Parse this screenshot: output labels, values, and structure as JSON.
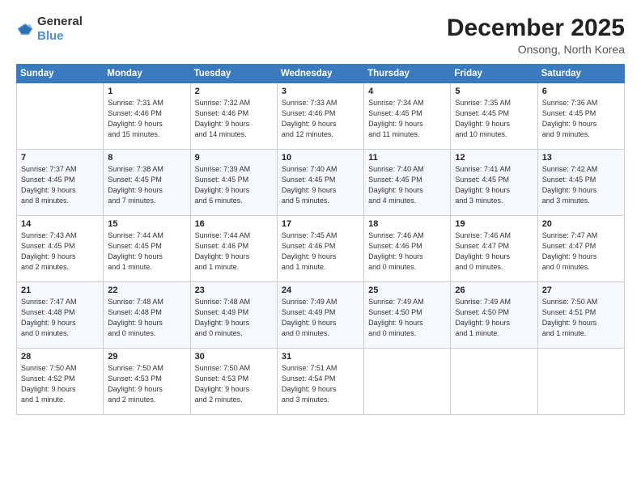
{
  "header": {
    "logo_general": "General",
    "logo_blue": "Blue",
    "month": "December 2025",
    "location": "Onsong, North Korea"
  },
  "days_of_week": [
    "Sunday",
    "Monday",
    "Tuesday",
    "Wednesday",
    "Thursday",
    "Friday",
    "Saturday"
  ],
  "weeks": [
    [
      {
        "day": "",
        "info": ""
      },
      {
        "day": "1",
        "info": "Sunrise: 7:31 AM\nSunset: 4:46 PM\nDaylight: 9 hours\nand 15 minutes."
      },
      {
        "day": "2",
        "info": "Sunrise: 7:32 AM\nSunset: 4:46 PM\nDaylight: 9 hours\nand 14 minutes."
      },
      {
        "day": "3",
        "info": "Sunrise: 7:33 AM\nSunset: 4:46 PM\nDaylight: 9 hours\nand 12 minutes."
      },
      {
        "day": "4",
        "info": "Sunrise: 7:34 AM\nSunset: 4:45 PM\nDaylight: 9 hours\nand 11 minutes."
      },
      {
        "day": "5",
        "info": "Sunrise: 7:35 AM\nSunset: 4:45 PM\nDaylight: 9 hours\nand 10 minutes."
      },
      {
        "day": "6",
        "info": "Sunrise: 7:36 AM\nSunset: 4:45 PM\nDaylight: 9 hours\nand 9 minutes."
      }
    ],
    [
      {
        "day": "7",
        "info": "Sunrise: 7:37 AM\nSunset: 4:45 PM\nDaylight: 9 hours\nand 8 minutes."
      },
      {
        "day": "8",
        "info": "Sunrise: 7:38 AM\nSunset: 4:45 PM\nDaylight: 9 hours\nand 7 minutes."
      },
      {
        "day": "9",
        "info": "Sunrise: 7:39 AM\nSunset: 4:45 PM\nDaylight: 9 hours\nand 6 minutes."
      },
      {
        "day": "10",
        "info": "Sunrise: 7:40 AM\nSunset: 4:45 PM\nDaylight: 9 hours\nand 5 minutes."
      },
      {
        "day": "11",
        "info": "Sunrise: 7:40 AM\nSunset: 4:45 PM\nDaylight: 9 hours\nand 4 minutes."
      },
      {
        "day": "12",
        "info": "Sunrise: 7:41 AM\nSunset: 4:45 PM\nDaylight: 9 hours\nand 3 minutes."
      },
      {
        "day": "13",
        "info": "Sunrise: 7:42 AM\nSunset: 4:45 PM\nDaylight: 9 hours\nand 3 minutes."
      }
    ],
    [
      {
        "day": "14",
        "info": "Sunrise: 7:43 AM\nSunset: 4:45 PM\nDaylight: 9 hours\nand 2 minutes."
      },
      {
        "day": "15",
        "info": "Sunrise: 7:44 AM\nSunset: 4:45 PM\nDaylight: 9 hours\nand 1 minute."
      },
      {
        "day": "16",
        "info": "Sunrise: 7:44 AM\nSunset: 4:46 PM\nDaylight: 9 hours\nand 1 minute."
      },
      {
        "day": "17",
        "info": "Sunrise: 7:45 AM\nSunset: 4:46 PM\nDaylight: 9 hours\nand 1 minute."
      },
      {
        "day": "18",
        "info": "Sunrise: 7:46 AM\nSunset: 4:46 PM\nDaylight: 9 hours\nand 0 minutes."
      },
      {
        "day": "19",
        "info": "Sunrise: 7:46 AM\nSunset: 4:47 PM\nDaylight: 9 hours\nand 0 minutes."
      },
      {
        "day": "20",
        "info": "Sunrise: 7:47 AM\nSunset: 4:47 PM\nDaylight: 9 hours\nand 0 minutes."
      }
    ],
    [
      {
        "day": "21",
        "info": "Sunrise: 7:47 AM\nSunset: 4:48 PM\nDaylight: 9 hours\nand 0 minutes."
      },
      {
        "day": "22",
        "info": "Sunrise: 7:48 AM\nSunset: 4:48 PM\nDaylight: 9 hours\nand 0 minutes."
      },
      {
        "day": "23",
        "info": "Sunrise: 7:48 AM\nSunset: 4:49 PM\nDaylight: 9 hours\nand 0 minutes."
      },
      {
        "day": "24",
        "info": "Sunrise: 7:49 AM\nSunset: 4:49 PM\nDaylight: 9 hours\nand 0 minutes."
      },
      {
        "day": "25",
        "info": "Sunrise: 7:49 AM\nSunset: 4:50 PM\nDaylight: 9 hours\nand 0 minutes."
      },
      {
        "day": "26",
        "info": "Sunrise: 7:49 AM\nSunset: 4:50 PM\nDaylight: 9 hours\nand 1 minute."
      },
      {
        "day": "27",
        "info": "Sunrise: 7:50 AM\nSunset: 4:51 PM\nDaylight: 9 hours\nand 1 minute."
      }
    ],
    [
      {
        "day": "28",
        "info": "Sunrise: 7:50 AM\nSunset: 4:52 PM\nDaylight: 9 hours\nand 1 minute."
      },
      {
        "day": "29",
        "info": "Sunrise: 7:50 AM\nSunset: 4:53 PM\nDaylight: 9 hours\nand 2 minutes."
      },
      {
        "day": "30",
        "info": "Sunrise: 7:50 AM\nSunset: 4:53 PM\nDaylight: 9 hours\nand 2 minutes."
      },
      {
        "day": "31",
        "info": "Sunrise: 7:51 AM\nSunset: 4:54 PM\nDaylight: 9 hours\nand 3 minutes."
      },
      {
        "day": "",
        "info": ""
      },
      {
        "day": "",
        "info": ""
      },
      {
        "day": "",
        "info": ""
      }
    ]
  ]
}
